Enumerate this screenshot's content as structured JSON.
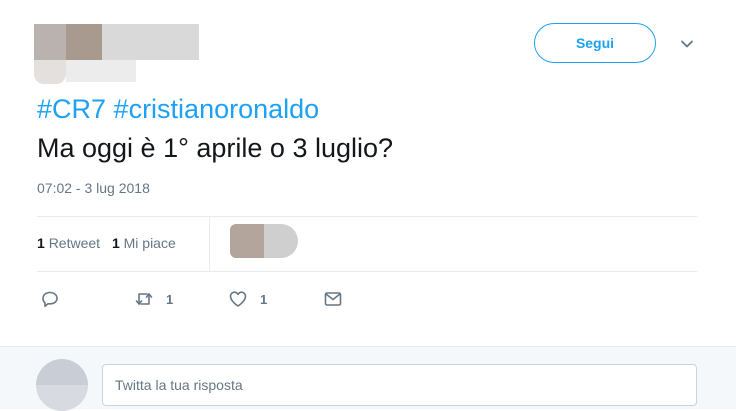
{
  "tweet": {
    "follow_label": "Segui",
    "hashtags": [
      "#CR7",
      "#cristianoronaldo"
    ],
    "text": "Ma oggi è 1° aprile o 3 luglio?",
    "timestamp": "07:02 - 3 lug 2018",
    "stats": {
      "retweets_count": "1",
      "retweets_label": "Retweet",
      "likes_count": "1",
      "likes_label": "Mi piace"
    },
    "actions": {
      "reply_icon": "reply-icon",
      "retweet_icon": "retweet-icon",
      "retweet_count": "1",
      "like_icon": "heart-icon",
      "like_count": "1",
      "dm_icon": "envelope-icon"
    }
  },
  "reply": {
    "placeholder": "Twitta la tua risposta"
  },
  "colors": {
    "accent": "#1da1f2",
    "secondary_text": "#657786",
    "primary_text": "#14171a",
    "divider": "#e6ecf0",
    "reply_bg": "#f5f8fa"
  }
}
